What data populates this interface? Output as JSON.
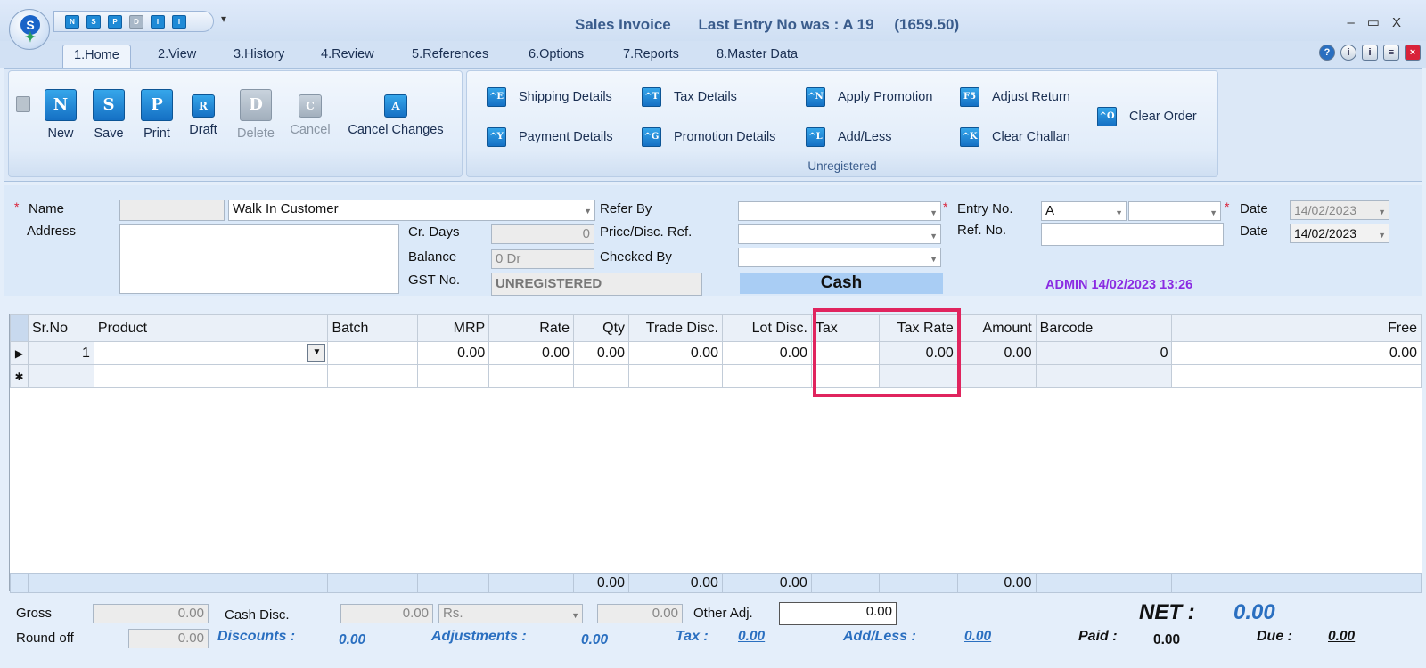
{
  "title_bar": {
    "title": "Sales Invoice",
    "last_entry": "Last Entry No was : A 19",
    "last_amount": "(1659.50)",
    "logo_letter": "S",
    "quick_access": [
      "N",
      "S",
      "P",
      "D",
      "I",
      "I"
    ],
    "qat_dropdown": "▾",
    "window_controls": [
      "–",
      "▭",
      "X"
    ]
  },
  "tabs": [
    "1.Home",
    "2.View",
    "3.History",
    "4.Review",
    "5.References",
    "6.Options",
    "7.Reports",
    "8.Master Data"
  ],
  "active_tab": "1.Home",
  "help_icons": [
    "help-icon",
    "info-icon",
    "about-icon",
    "notes-icon",
    "exit-icon"
  ],
  "ribbon": {
    "main_buttons": [
      {
        "label": "New",
        "glyph": "N",
        "enabled": true
      },
      {
        "label": "Save",
        "glyph": "S",
        "enabled": true
      },
      {
        "label": "Print",
        "glyph": "P",
        "enabled": true
      },
      {
        "label": "Draft",
        "glyph": "R",
        "enabled": true
      },
      {
        "label": "Delete",
        "glyph": "D",
        "enabled": false
      },
      {
        "label": "Cancel",
        "glyph": "C",
        "enabled": false
      },
      {
        "label": "Cancel Changes",
        "glyph": "A",
        "enabled": true
      }
    ],
    "actions": [
      {
        "label": "Shipping Details",
        "key": "^E"
      },
      {
        "label": "Payment Details",
        "key": "^Y"
      },
      {
        "label": "Tax Details",
        "key": "^T"
      },
      {
        "label": "Promotion Details",
        "key": "^G"
      },
      {
        "label": "Apply Promotion",
        "key": "^N"
      },
      {
        "label": "Add/Less",
        "key": "^L"
      },
      {
        "label": "Adjust Return",
        "key": "F5"
      },
      {
        "label": "Clear Challan",
        "key": "^K"
      },
      {
        "label": "Clear Order",
        "key": "^O"
      }
    ],
    "group_label": "Unregistered"
  },
  "form": {
    "name_label": "Name",
    "name_code": "",
    "name_value": "Walk In Customer",
    "address_label": "Address",
    "address_value": "",
    "cr_days_label": "Cr. Days",
    "cr_days_value": "0",
    "balance_label": "Balance",
    "balance_value": "0 Dr",
    "gst_label": "GST No.",
    "gst_value": "UNREGISTERED",
    "refer_by_label": "Refer By",
    "refer_by_value": "",
    "price_ref_label": "Price/Disc. Ref.",
    "price_ref_value": "",
    "checked_by_label": "Checked By",
    "checked_by_value": "",
    "payment_mode": "Cash",
    "entry_no_label": "Entry No.",
    "entry_series": "A",
    "entry_number": "",
    "ref_no_label": "Ref. No.",
    "ref_no_value": "",
    "date_label": "Date",
    "date_value": "14/02/2023",
    "date2_label": "Date",
    "date2_value": "14/02/2023",
    "admin_stamp": "ADMIN 14/02/2023 13:26"
  },
  "grid": {
    "columns": [
      "Sr.No",
      "Product",
      "Batch",
      "MRP",
      "Rate",
      "Qty",
      "Trade Disc.",
      "Lot Disc.",
      "Tax",
      "Tax Rate",
      "Amount",
      "Barcode",
      "Free"
    ],
    "rows": [
      [
        "1",
        "",
        "",
        "0.00",
        "0.00",
        "0.00",
        "0.00",
        "0.00",
        "",
        "0.00",
        "0.00",
        "0",
        ""
      ]
    ],
    "free_value": "0.00",
    "row_indicator": "▶",
    "new_row_indicator": "✱",
    "totals": {
      "qty": "0.00",
      "trade_disc": "0.00",
      "lot_disc": "0.00",
      "amount": "0.00"
    }
  },
  "summary": {
    "gross_label": "Gross",
    "gross_value": "0.00",
    "cash_disc_label": "Cash Disc.",
    "cash_disc_value": "0.00",
    "cash_disc_unit": "Rs.",
    "cash_disc_amount": "0.00",
    "other_adj_label": "Other Adj.",
    "other_adj_value": "0.00",
    "round_off_label": "Round off",
    "round_off_value": "0.00",
    "discounts_label": "Discounts :",
    "discounts_value": "0.00",
    "adjustments_label": "Adjustments :",
    "adjustments_value": "0.00",
    "tax_label": "Tax :",
    "tax_value": "0.00",
    "add_less_label": "Add/Less :",
    "add_less_value": "0.00",
    "net_label": "NET :",
    "net_value": "0.00",
    "paid_label": "Paid :",
    "paid_value": "0.00",
    "due_label": "Due :",
    "due_value": "0.00"
  },
  "colors": {
    "highlight": "#e0245e",
    "accent": "#2a6fc0",
    "admin": "#8a2be2"
  }
}
